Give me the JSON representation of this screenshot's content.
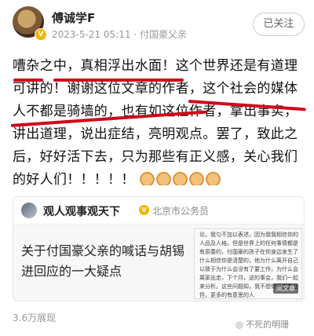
{
  "header": {
    "name": "傅诚学F",
    "badge": "V",
    "meta": "2023-5-21 05:11 · 付国豪父亲",
    "follow_label": "已关注"
  },
  "post": {
    "segments": [
      "嘈杂之中，真相浮出水面！这个世界还是有道理",
      "可讲的！谢谢这位文章的作者，这个社会的媒体",
      "人不都是骑墙的，也有如这位作者，拿出事实，",
      "讲出道理，说出症结，亮明观点。罢了，致此之",
      "后，好好活下去，只为那些有正义感，关心我们",
      "的好人们！！！！！"
    ],
    "emoji_icon": "handshake-emoji",
    "emoji_count": 5,
    "underline_color": "#d0021b"
  },
  "card": {
    "author": "观人观事观天下",
    "official_badge": "V",
    "official_label": "北京市公务员",
    "title": "关于付国豪父亲的喊话与胡锡进回应的一大疑点",
    "thumb_text": "论。我匀不加以表述。因为我我相信你的人品及人格。但是世界上的任何事情都是有原委的，付国豪的孩子在你身边发生了什么相信你是清楚的，他为什么离开自己以致于为什么会没有了要工作，为什么会离家出走，下个月，这的事会，我们一起来分析。这些问题知，我不想你就是失业但，更多的有意思的人",
    "thumb_tag": "阅文章"
  },
  "footer": {
    "views": "3.6万展现",
    "watermark": "不死的明珊"
  }
}
